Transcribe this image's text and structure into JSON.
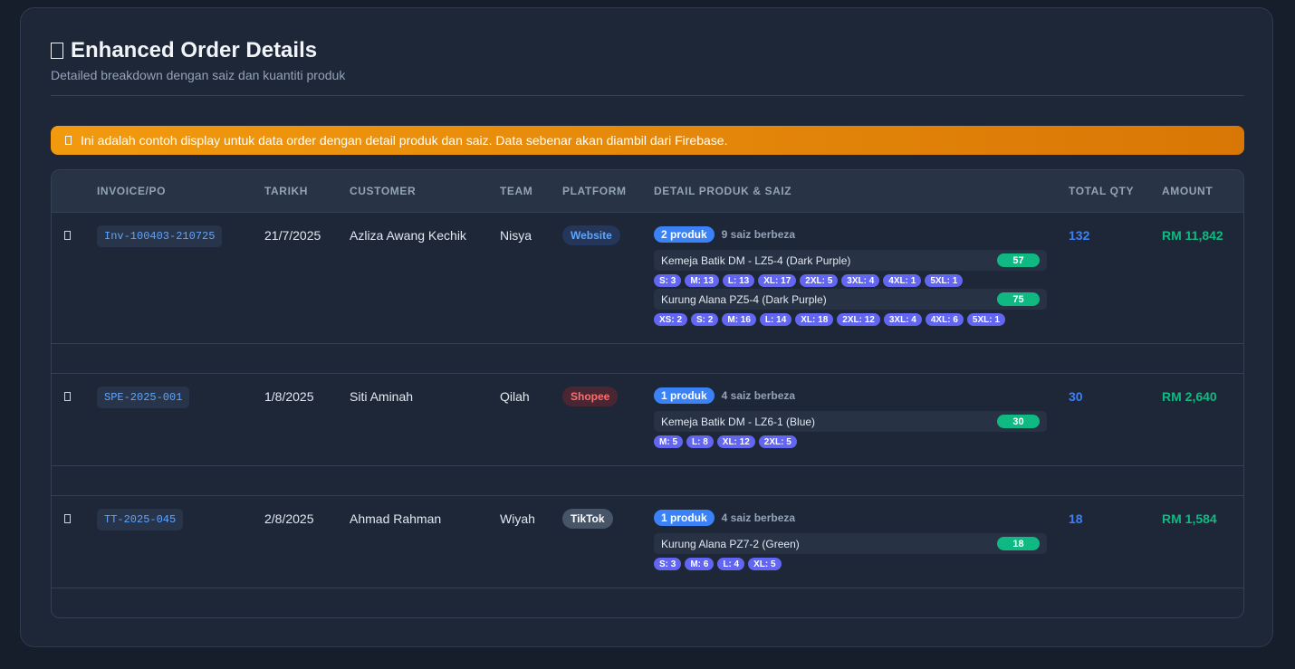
{
  "header": {
    "title": "Enhanced Order Details",
    "subtitle": "Detailed breakdown dengan saiz dan kuantiti produk"
  },
  "alert": {
    "text": "Ini adalah contoh display untuk data order dengan detail produk dan saiz. Data sebenar akan diambil dari Firebase."
  },
  "table": {
    "columns": [
      "INVOICE/PO",
      "TARIKH",
      "CUSTOMER",
      "TEAM",
      "PLATFORM",
      "DETAIL PRODUK & SAIZ",
      "TOTAL QTY",
      "AMOUNT"
    ],
    "rows": [
      {
        "invoice": "Inv-100403-210725",
        "date": "21/7/2025",
        "customer": "Azliza Awang Kechik",
        "team": "Nisya",
        "platform": "Website",
        "product_count": "2 produk",
        "size_count": "9 saiz berbeza",
        "products": [
          {
            "name": "Kemeja Batik DM - LZ5-4 (Dark Purple)",
            "qty": "57",
            "sizes": [
              "S: 3",
              "M: 13",
              "L: 13",
              "XL: 17",
              "2XL: 5",
              "3XL: 4",
              "4XL: 1",
              "5XL: 1"
            ]
          },
          {
            "name": "Kurung Alana PZ5-4 (Dark Purple)",
            "qty": "75",
            "sizes": [
              "XS: 2",
              "S: 2",
              "M: 16",
              "L: 14",
              "XL: 18",
              "2XL: 12",
              "3XL: 4",
              "4XL: 6",
              "5XL: 1"
            ]
          }
        ],
        "total_qty": "132",
        "amount": "RM 11,842"
      },
      {
        "invoice": "SPE-2025-001",
        "date": "1/8/2025",
        "customer": "Siti Aminah",
        "team": "Qilah",
        "platform": "Shopee",
        "product_count": "1 produk",
        "size_count": "4 saiz berbeza",
        "products": [
          {
            "name": "Kemeja Batik DM - LZ6-1 (Blue)",
            "qty": "30",
            "sizes": [
              "M: 5",
              "L: 8",
              "XL: 12",
              "2XL: 5"
            ]
          }
        ],
        "total_qty": "30",
        "amount": "RM 2,640"
      },
      {
        "invoice": "TT-2025-045",
        "date": "2/8/2025",
        "customer": "Ahmad Rahman",
        "team": "Wiyah",
        "platform": "TikTok",
        "product_count": "1 produk",
        "size_count": "4 saiz berbeza",
        "products": [
          {
            "name": "Kurung Alana PZ7-2 (Green)",
            "qty": "18",
            "sizes": [
              "S: 3",
              "M: 6",
              "L: 4",
              "XL: 5"
            ]
          }
        ],
        "total_qty": "18",
        "amount": "RM 1,584"
      }
    ]
  },
  "colors": {
    "accent_blue": "#3b82f6",
    "accent_green": "#10b981",
    "size_badge": "#6366f1",
    "alert_orange": "#f29a0e"
  }
}
